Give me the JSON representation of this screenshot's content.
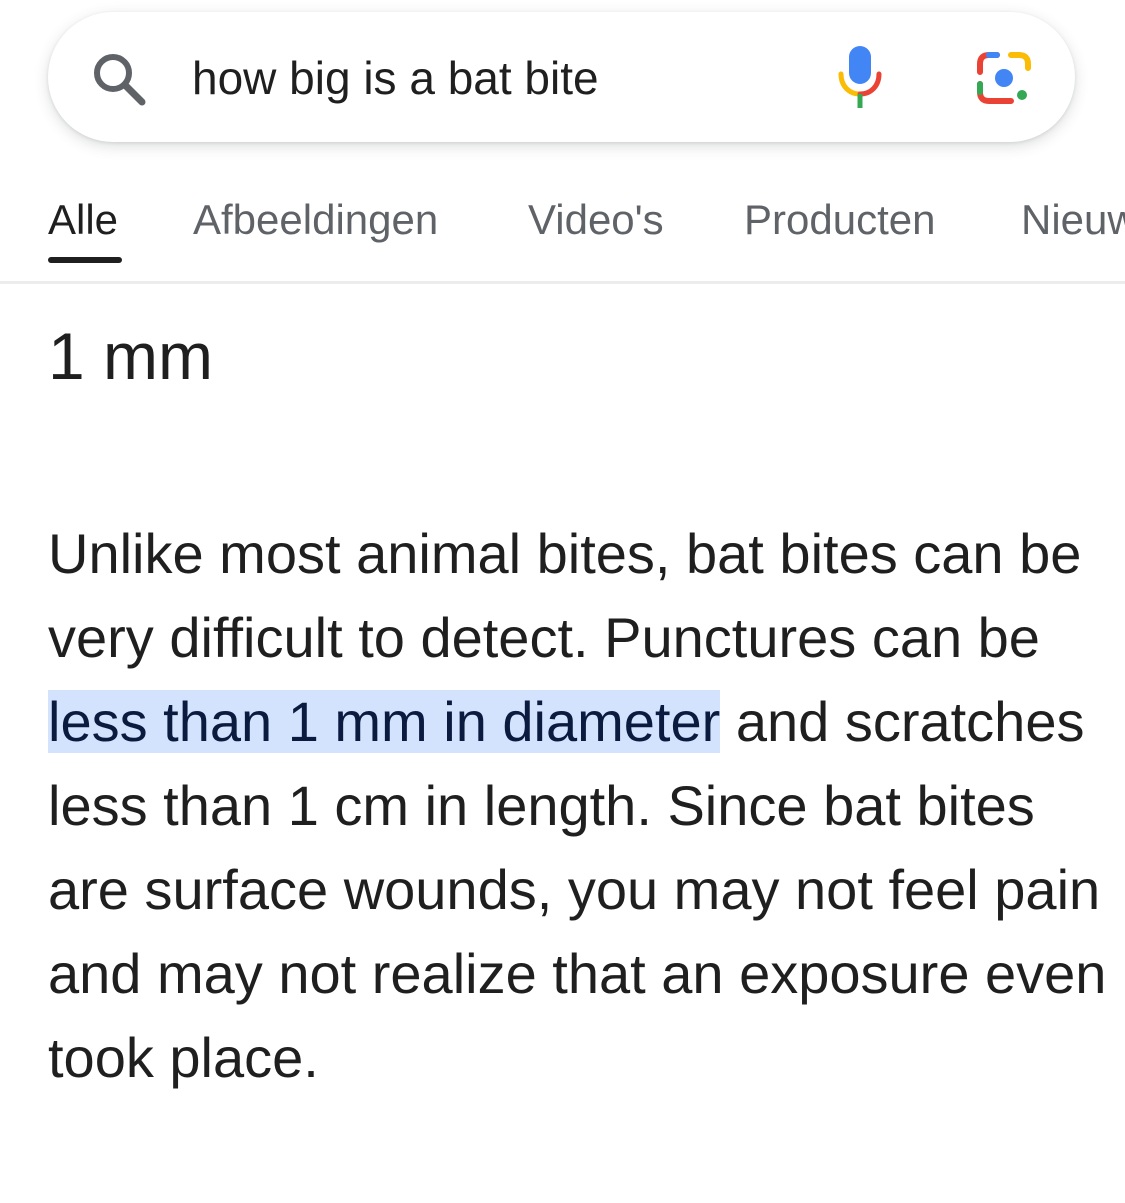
{
  "search": {
    "query": "how big is a bat bite"
  },
  "tabs": [
    {
      "label": "Alle",
      "active": true
    },
    {
      "label": "Afbeeldingen",
      "active": false
    },
    {
      "label": "Video's",
      "active": false
    },
    {
      "label": "Producten",
      "active": false
    },
    {
      "label": "Nieuws",
      "active": false
    }
  ],
  "answer": {
    "title": "1 mm",
    "snippet_before": "Unlike most animal bites, bat bites can be very difficult to detect. Punctures can be ",
    "snippet_highlight": "less than 1 mm in diameter",
    "snippet_after": " and scratches less than 1 cm in length. Since bat bites are surface wounds, you may not feel pain and may not realize that an exposure even took place."
  },
  "icons": {
    "search": "search-icon",
    "mic": "mic-icon",
    "lens": "lens-icon"
  },
  "colors": {
    "highlight": "#d3e3fd",
    "google_blue": "#4285f4",
    "google_red": "#ea4335",
    "google_yellow": "#fbbc05",
    "google_green": "#34a853"
  }
}
